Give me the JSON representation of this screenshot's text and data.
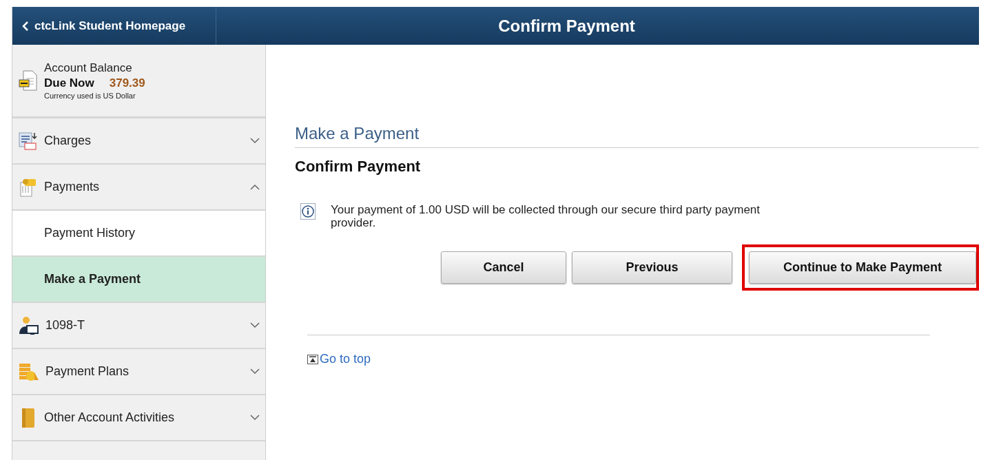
{
  "header": {
    "back_label": "ctcLink Student Homepage",
    "title": "Confirm Payment"
  },
  "sidebar": {
    "balance": {
      "title": "Account Balance",
      "due_label": "Due Now",
      "due_amount": "379.39",
      "note": "Currency used is US Dollar"
    },
    "items": [
      {
        "kind": "section",
        "label": "Charges",
        "expanded": false,
        "selected": false
      },
      {
        "kind": "section",
        "label": "Payments",
        "expanded": true,
        "selected": false
      },
      {
        "kind": "subitem",
        "label": "Payment History",
        "selected": false
      },
      {
        "kind": "subitem",
        "label": "Make a Payment",
        "selected": true
      },
      {
        "kind": "section",
        "label": "1098-T",
        "expanded": false,
        "selected": false
      },
      {
        "kind": "section",
        "label": "Payment Plans",
        "expanded": false,
        "selected": false
      },
      {
        "kind": "section",
        "label": "Other Account Activities",
        "expanded": false,
        "selected": false
      }
    ]
  },
  "content": {
    "page_title": "Make a Payment",
    "subtitle": "Confirm Payment",
    "message": "Your payment of 1.00 USD will be collected through our secure third party payment provider.",
    "buttons": [
      {
        "label": "Cancel",
        "highlighted": false
      },
      {
        "label": "Previous",
        "highlighted": false
      },
      {
        "label": "Continue to Make Payment",
        "highlighted": true
      }
    ],
    "top_link": "Go to top"
  }
}
